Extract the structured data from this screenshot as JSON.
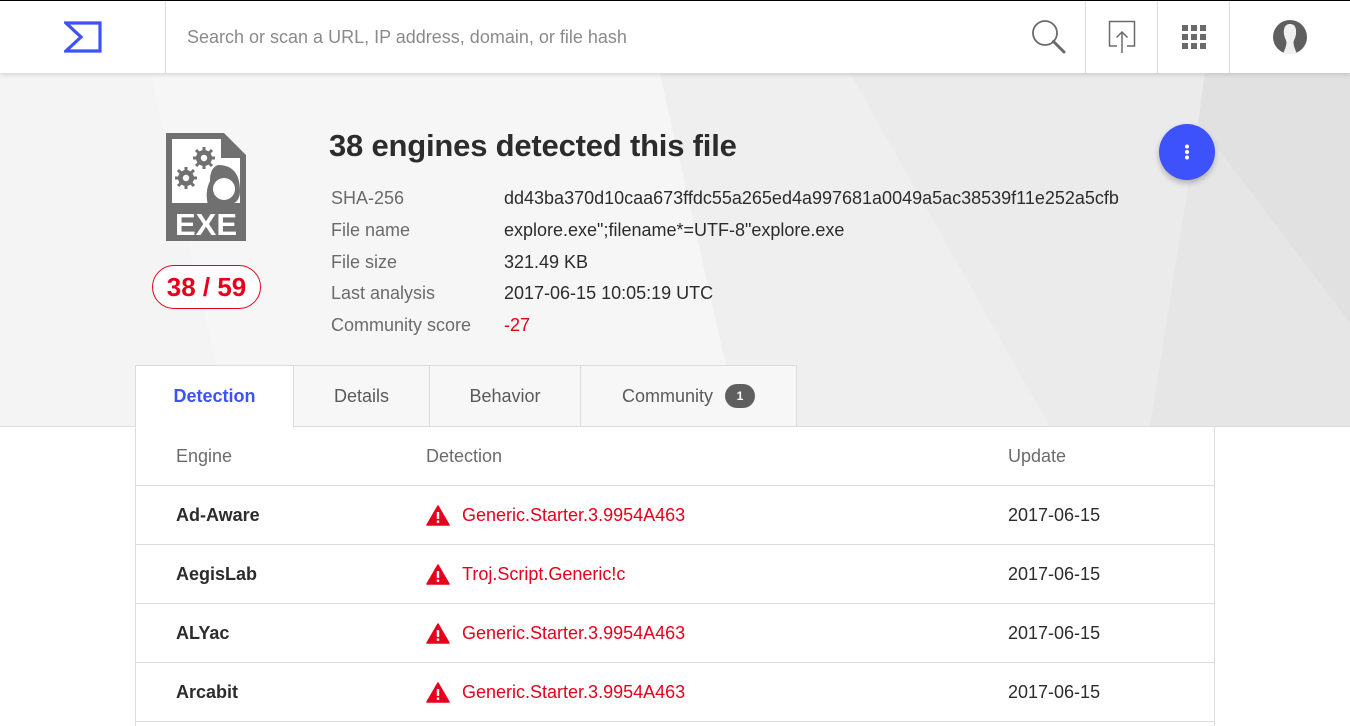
{
  "topbar": {
    "logo": "virustotal-sigma-logo",
    "search_placeholder": "Search or scan a URL, IP address, domain, or file hash",
    "search_value": "",
    "icons": [
      "search-icon",
      "upload-icon",
      "apps-grid-icon",
      "user-avatar-icon"
    ]
  },
  "summary": {
    "file_type_icon": "exe-file-icon",
    "file_type_label": "EXE",
    "detection_ratio": "38 / 59",
    "title": "38 engines detected this file",
    "details": [
      {
        "label": "SHA-256",
        "value": "dd43ba370d10caa673ffdc55a265ed4a997681a0049a5ac38539f11e252a5cfb"
      },
      {
        "label": "File name",
        "value": "explore.exe\";filename*=UTF-8\"explore.exe"
      },
      {
        "label": "File size",
        "value": "321.49 KB"
      },
      {
        "label": "Last analysis",
        "value": "2017-06-15 10:05:19 UTC"
      },
      {
        "label": "Community score",
        "value": "-27"
      }
    ],
    "more_actions_icon": "more-vertical-icon"
  },
  "tabs": [
    {
      "label": "Detection",
      "active": true
    },
    {
      "label": "Details",
      "active": false
    },
    {
      "label": "Behavior",
      "active": false
    },
    {
      "label": "Community",
      "active": false,
      "badge": "1"
    }
  ],
  "table": {
    "columns": [
      "Engine",
      "Detection",
      "Update"
    ],
    "rows": [
      {
        "engine": "Ad-Aware",
        "detection": "Generic.Starter.3.9954A463",
        "update": "2017-06-15"
      },
      {
        "engine": "AegisLab",
        "detection": "Troj.Script.Generic!c",
        "update": "2017-06-15"
      },
      {
        "engine": "ALYac",
        "detection": "Generic.Starter.3.9954A463",
        "update": "2017-06-15"
      },
      {
        "engine": "Arcabit",
        "detection": "Generic.Starter.3.9954A463",
        "update": "2017-06-15"
      }
    ]
  },
  "colors": {
    "accent": "#3d52fa",
    "danger": "#e6001c",
    "badge_bg": "#5f5f5f"
  }
}
